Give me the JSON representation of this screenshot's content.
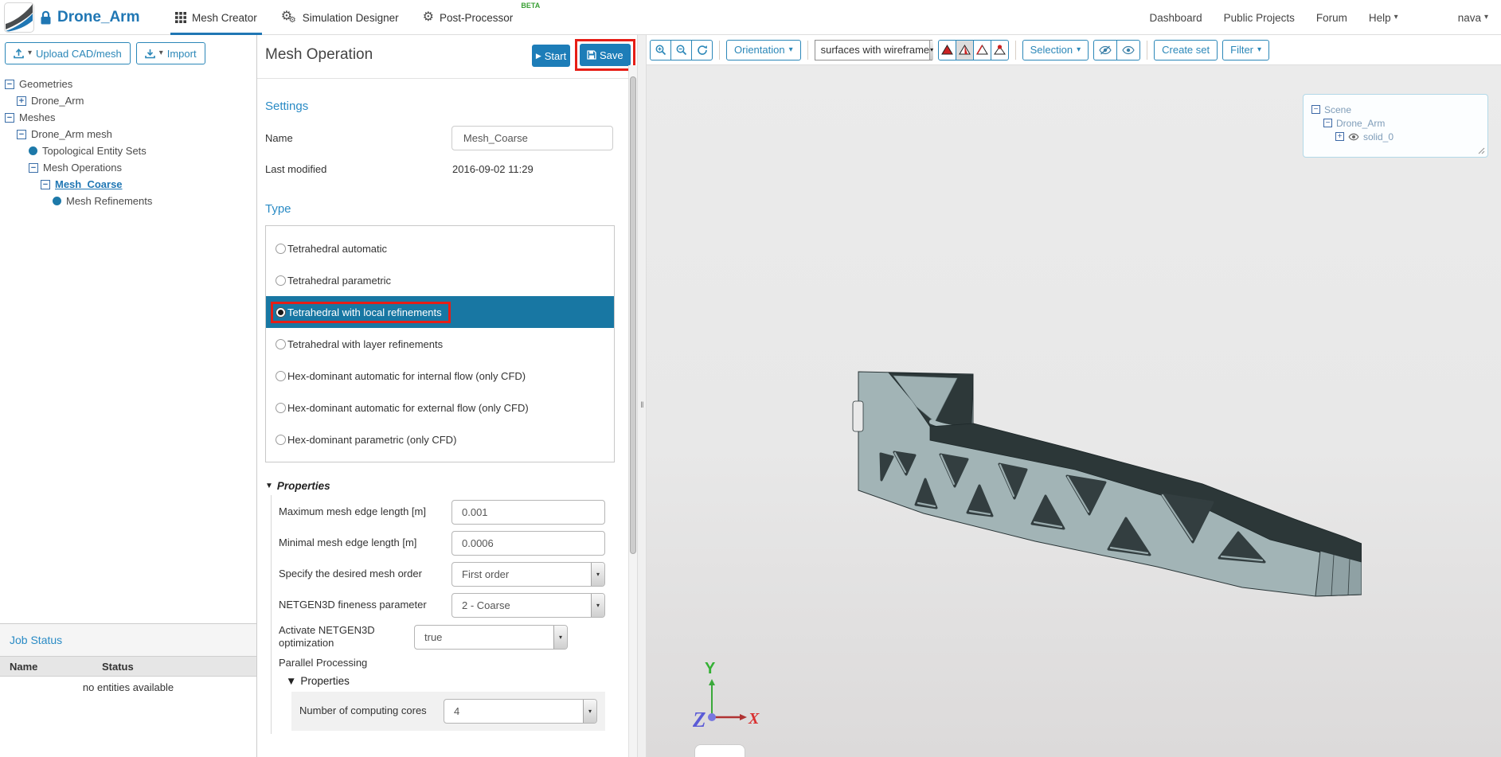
{
  "navbar": {
    "project": "Drone_Arm",
    "tabs": [
      {
        "label": "Mesh Creator",
        "active": true
      },
      {
        "label": "Simulation Designer",
        "active": false
      },
      {
        "label": "Post-Processor",
        "active": false,
        "beta": "BETA"
      }
    ],
    "links": [
      {
        "label": "Dashboard"
      },
      {
        "label": "Public Projects"
      },
      {
        "label": "Forum"
      },
      {
        "label": "Help"
      }
    ],
    "user": "nava"
  },
  "sidebar": {
    "upload_button": "Upload CAD/mesh",
    "import_button": "Import",
    "tree": [
      {
        "label": "Geometries",
        "icon": "minus",
        "indent": 0
      },
      {
        "label": "Drone_Arm",
        "icon": "plus",
        "indent": 1
      },
      {
        "label": "Meshes",
        "icon": "minus",
        "indent": 0
      },
      {
        "label": "Drone_Arm mesh",
        "icon": "minus",
        "indent": 1
      },
      {
        "label": "Topological Entity Sets",
        "icon": "dot",
        "indent": 2
      },
      {
        "label": "Mesh Operations",
        "icon": "minus",
        "indent": 2
      },
      {
        "label": "Mesh_Coarse",
        "icon": "minus",
        "indent": 3,
        "selected": true
      },
      {
        "label": "Mesh Refinements",
        "icon": "dot",
        "indent": 4
      }
    ],
    "job_status": {
      "title": "Job Status",
      "col_name": "Name",
      "col_status": "Status",
      "empty": "no entities available"
    }
  },
  "panel": {
    "title": "Mesh Operation",
    "start": "Start",
    "save": "Save",
    "settings": {
      "heading": "Settings",
      "name_label": "Name",
      "name_value": "Mesh_Coarse",
      "modified_label": "Last modified",
      "modified_value": "2016-09-02 11:29"
    },
    "type": {
      "heading": "Type",
      "selected_index": 2,
      "options": [
        {
          "label": "Tetrahedral automatic"
        },
        {
          "label": "Tetrahedral parametric"
        },
        {
          "label": "Tetrahedral with local refinements"
        },
        {
          "label": "Tetrahedral with layer refinements"
        },
        {
          "label": "Hex-dominant automatic for internal flow (only CFD)"
        },
        {
          "label": "Hex-dominant automatic for external flow (only CFD)"
        },
        {
          "label": "Hex-dominant parametric (only CFD)"
        }
      ]
    },
    "properties": {
      "heading": "Properties",
      "max_edge_label": "Maximum mesh edge length [m]",
      "max_edge_value": "0.001",
      "min_edge_label": "Minimal mesh edge length [m]",
      "min_edge_value": "0.0006",
      "order_label": "Specify the desired mesh order",
      "order_value": "First order",
      "fineness_label": "NETGEN3D fineness parameter",
      "fineness_value": "2 - Coarse",
      "optim_label": "Activate NETGEN3D optimization",
      "optim_value": "true",
      "parallel_label": "Parallel Processing",
      "nested_heading": "Properties",
      "cores_label": "Number of computing cores",
      "cores_value": "4"
    }
  },
  "viewport": {
    "toolbar": {
      "orientation": "Orientation",
      "display_mode": "surfaces with wireframe",
      "selection": "Selection",
      "create_set": "Create set",
      "filter": "Filter"
    },
    "scene": {
      "root": "Scene",
      "child": "Drone_Arm",
      "solid": "solid_0"
    },
    "axes": {
      "x": "X",
      "y": "Y",
      "z": "Z"
    }
  },
  "icons": {
    "caret_down": "▾",
    "play": "▶",
    "collapse_tri": "▼",
    "tree_minus": "−",
    "tree_plus": "+",
    "grip": "‖",
    "gear": "⚙"
  },
  "colors": {
    "accent_blue": "#2077b4",
    "heading_blue": "#2a8bc5",
    "selected_row_blue": "#1877a3",
    "annotation_red": "#e61e16",
    "beta_green": "#3aa035",
    "model_light": "#a2b4b6",
    "model_dark": "#2d3839"
  }
}
